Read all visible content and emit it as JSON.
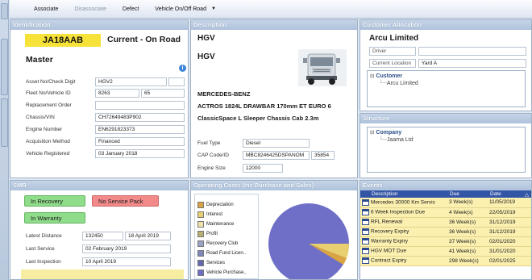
{
  "toolbar": {
    "associate": "Associate",
    "disassociate": "Disassociate",
    "defect": "Defect",
    "vehicle_onoff_road": "Vehicle On/Off Road"
  },
  "identification": {
    "title": "Identification",
    "registration": "JA18AAB",
    "status": "Current - On Road",
    "master": "Master",
    "fields": [
      {
        "label": "Asset No/Check Digit",
        "value": "HGV2",
        "value2": ""
      },
      {
        "label": "Fleet No/Vehicle ID",
        "value": "8263",
        "value2": "65"
      },
      {
        "label": "Replacement Order",
        "value": ""
      },
      {
        "label": "Chassis/VIN",
        "value": "CH72649483P902"
      },
      {
        "label": "Engine Number",
        "value": "EN6291823373"
      },
      {
        "label": "Acquisition Method",
        "value": "Financed"
      },
      {
        "label": "Vehicle Registered",
        "value": "03 January 2018"
      }
    ]
  },
  "description": {
    "title": "Description",
    "line1": "HGV",
    "line2": "HGV",
    "make": "MERCEDES-BENZ",
    "model": "ACTROS 1824L DRAWBAR 170mm ET EURO 6",
    "body": "ClassicSpace L Sleeper Chassis Cab 2.3m",
    "fuel_label": "Fuel Type",
    "fuel": "Diesel",
    "cap_label": "CAP Code/ID",
    "cap_code": "MBC8246425DSPANOM",
    "cap_id": "35854",
    "engine_label": "Engine Size",
    "engine_size": "12000"
  },
  "customer": {
    "title": "Customer Allocation",
    "name": "Arcu Limited",
    "driver_label": "Driver",
    "driver": "",
    "location_label": "Current Location",
    "location": "Yard A",
    "tree_root": "Customer",
    "tree_child": "Arcu Limited"
  },
  "structure": {
    "title": "Structure",
    "tree_root": "Company",
    "tree_child": "Jaama Ltd"
  },
  "smr": {
    "title": "SMR",
    "in_recovery": "In Recovery",
    "no_service_pack": "No Service Pack",
    "in_warranty": "In Warranty",
    "latest_distance_label": "Latest Distance",
    "latest_distance": "132450",
    "latest_distance_date": "18 April 2019",
    "last_service_label": "Last Service",
    "last_service": "02 February 2019",
    "last_inspection_label": "Last Inspection",
    "last_inspection": "10 April 2019"
  },
  "operating_costs": {
    "title": "Operating Costs (Inc Purchase and Sales)",
    "legend": [
      {
        "label": "Depreciation",
        "color": "#d9a441"
      },
      {
        "label": "Interest",
        "color": "#e8d070"
      },
      {
        "label": "Maintenance",
        "color": "#efe3a8"
      },
      {
        "label": "Profit",
        "color": "#b8b070"
      },
      {
        "label": "Recovery Club",
        "color": "#9ba2c8"
      },
      {
        "label": "Road Fund Licen..",
        "color": "#7f86bb"
      },
      {
        "label": "Services",
        "color": "#6268b0"
      },
      {
        "label": "Vehicle Purchase..",
        "color": "#6f6fc8"
      }
    ]
  },
  "events": {
    "title": "Events",
    "columns": [
      "Description",
      "Due",
      "Date"
    ],
    "rows": [
      {
        "description": "Mercedes 30000 Km Servic",
        "due": "3 Week(s)",
        "date": "11/05/2019"
      },
      {
        "description": "6 Week Inspection Due",
        "due": "4 Week(s)",
        "date": "22/05/2019"
      },
      {
        "description": "RFL Renewal",
        "due": "36 Week(s)",
        "date": "31/12/2019"
      },
      {
        "description": "Recovery Expiry",
        "due": "36 Week(s)",
        "date": "31/12/2019"
      },
      {
        "description": "Warranty Expiry",
        "due": "37 Week(s)",
        "date": "02/01/2020"
      },
      {
        "description": "HGV MOT Due",
        "due": "41 Week(s)",
        "date": "31/01/2020"
      },
      {
        "description": "Contract Expiry",
        "due": "298 Week(s)",
        "date": "02/01/2025"
      }
    ]
  }
}
